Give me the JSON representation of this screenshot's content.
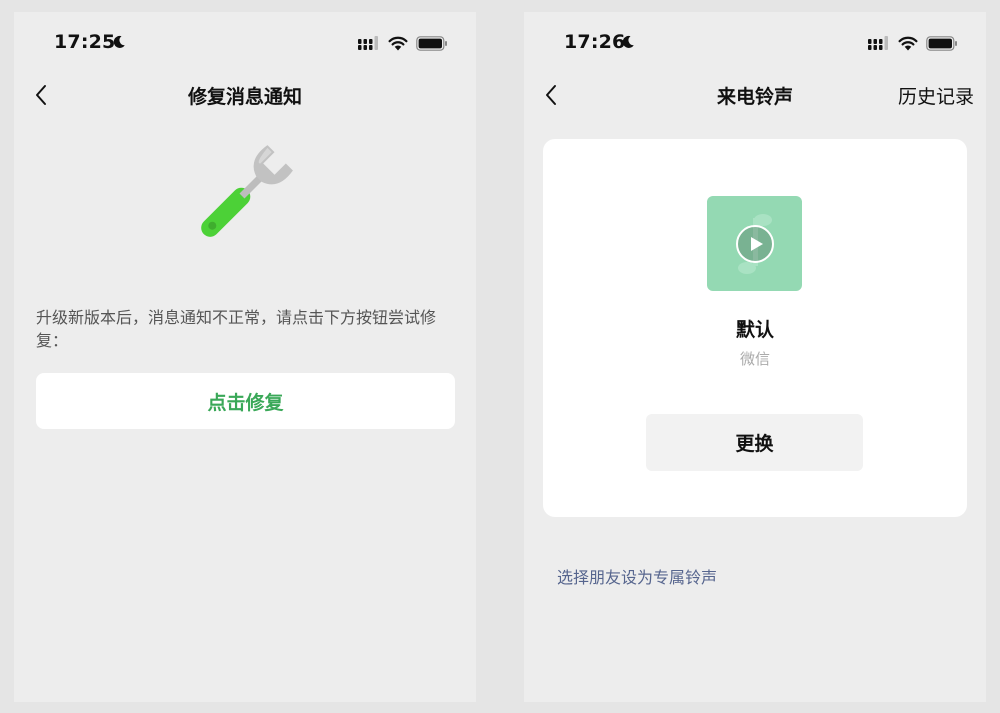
{
  "left_screen": {
    "status": {
      "time": "17:25",
      "icons": [
        "moon-icon",
        "cellular-signal-icon",
        "wifi-icon",
        "battery-icon"
      ]
    },
    "nav": {
      "back_icon": "chevron-left-icon",
      "title": "修复消息通知"
    },
    "illustration_icon": "wrench-icon",
    "notice": "升级新版本后，消息通知不正常，请点击下方按钮尝试修复：",
    "repair_button_label": "点击修复"
  },
  "right_screen": {
    "status": {
      "time": "17:26",
      "icons": [
        "moon-icon",
        "cellular-signal-icon",
        "wifi-icon",
        "battery-icon"
      ]
    },
    "nav": {
      "back_icon": "chevron-left-icon",
      "title": "来电铃声",
      "action_label": "历史记录"
    },
    "ringtone": {
      "cover_icon": "play-icon",
      "name": "默认",
      "source": "微信",
      "change_button_label": "更换"
    },
    "friend_link": "选择朋友设为专属铃声"
  },
  "colors": {
    "background": "#ededed",
    "card": "#ffffff",
    "accent_green": "#3aa858",
    "wrench_handle": "#4cd137",
    "cover_green": "#94d9b3",
    "link_blue": "#56658e",
    "muted_text": "#aaaaaa"
  }
}
